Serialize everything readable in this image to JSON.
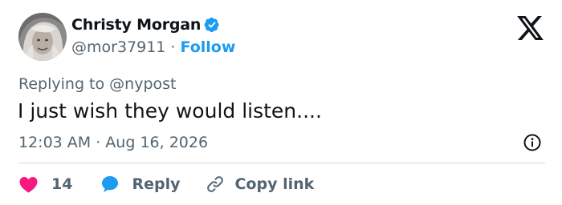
{
  "author": {
    "display_name": "Christy Morgan",
    "handle": "@mor37911",
    "separator": " · ",
    "follow_label": "Follow",
    "verified": true
  },
  "reply_context": {
    "prefix": "Replying to ",
    "mention": "@nypost"
  },
  "tweet": {
    "text": "I just wish they would listen....",
    "timestamp": "12:03 AM · Aug 16, 2026"
  },
  "actions": {
    "like_count": "14",
    "reply_label": "Reply",
    "copy_link_label": "Copy link"
  },
  "icons": {
    "brand": "x-logo-icon",
    "verified": "verified-badge-icon",
    "info": "info-icon",
    "like": "heart-icon",
    "reply": "speech-bubble-icon",
    "copy": "link-icon"
  },
  "colors": {
    "text_primary": "#0f1419",
    "text_secondary": "#536471",
    "accent": "#1d9bf0",
    "like": "#f91880",
    "divider": "#cfd9de"
  }
}
